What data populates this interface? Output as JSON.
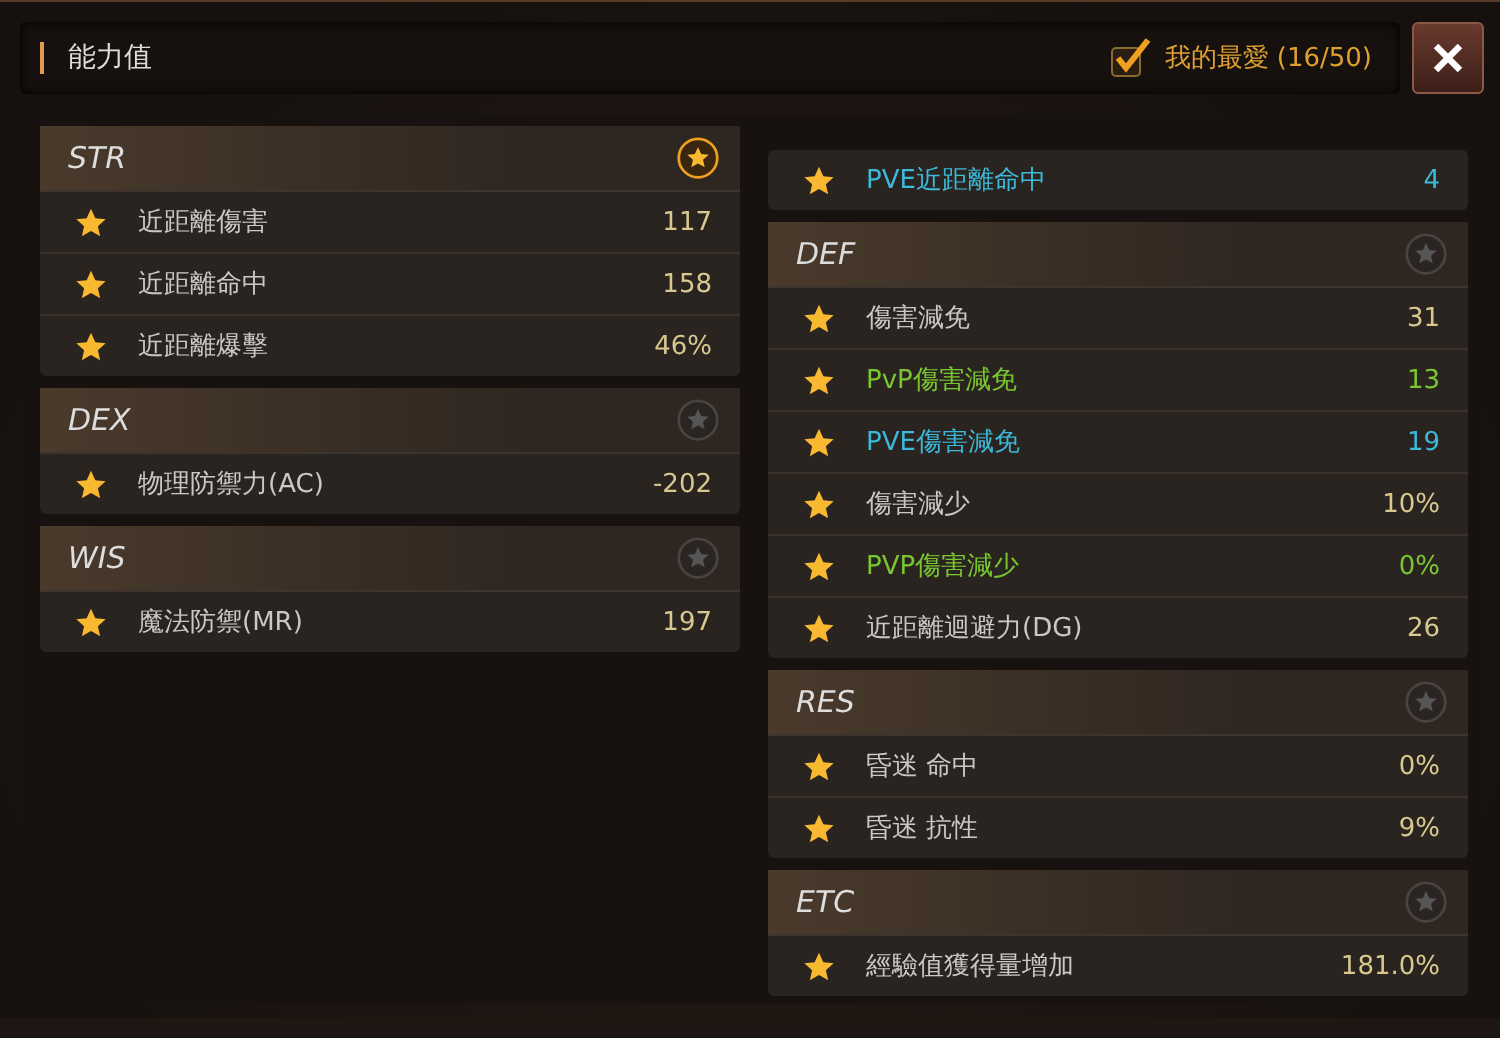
{
  "window": {
    "title": "能力值"
  },
  "favorites": {
    "label": "我的最愛 (16/50)",
    "checked": true
  },
  "left_column": [
    {
      "title": "STR",
      "favorite": true,
      "rows": [
        {
          "label": "近距離傷害",
          "value": "117",
          "kind": "normal"
        },
        {
          "label": "近距離命中",
          "value": "158",
          "kind": "normal"
        },
        {
          "label": "近距離爆擊",
          "value": "46%",
          "kind": "normal"
        }
      ]
    },
    {
      "title": "DEX",
      "favorite": false,
      "rows": [
        {
          "label": "物理防禦力(AC)",
          "value": "-202",
          "kind": "normal"
        }
      ]
    },
    {
      "title": "WIS",
      "favorite": false,
      "rows": [
        {
          "label": "魔法防禦(MR)",
          "value": "197",
          "kind": "normal"
        }
      ]
    }
  ],
  "right_column": [
    {
      "rows": [
        {
          "label": "PVE近距離命中",
          "value": "4",
          "kind": "pve"
        }
      ]
    },
    {
      "title": "DEF",
      "favorite": false,
      "rows": [
        {
          "label": "傷害減免",
          "value": "31",
          "kind": "normal"
        },
        {
          "label": "PvP傷害減免",
          "value": "13",
          "kind": "pvp"
        },
        {
          "label": "PVE傷害減免",
          "value": "19",
          "kind": "pve"
        },
        {
          "label": "傷害減少",
          "value": "10%",
          "kind": "normal"
        },
        {
          "label": "PVP傷害減少",
          "value": "0%",
          "kind": "pvp"
        },
        {
          "label": "近距離迴避力(DG)",
          "value": "26",
          "kind": "normal"
        }
      ]
    },
    {
      "title": "RES",
      "favorite": false,
      "rows": [
        {
          "label": "昏迷 命中",
          "value": "0%",
          "kind": "normal"
        },
        {
          "label": "昏迷 抗性",
          "value": "9%",
          "kind": "normal"
        }
      ]
    },
    {
      "title": "ETC",
      "favorite": false,
      "rows": [
        {
          "label": "經驗值獲得量增加",
          "value": "181.0%",
          "kind": "normal"
        }
      ]
    }
  ]
}
